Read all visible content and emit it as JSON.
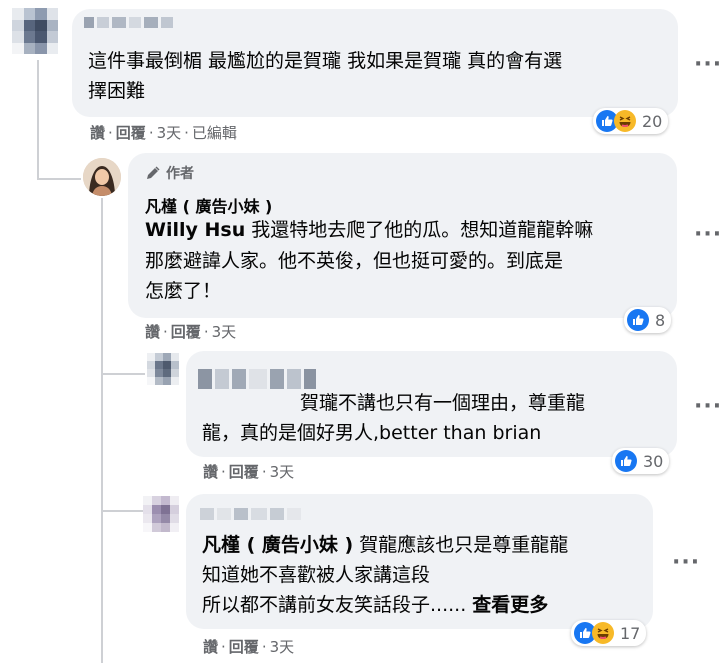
{
  "comments": [
    {
      "id": "c1",
      "text_line1": "這件事最倒楣 最尷尬的是賀瓏 我如果是賀瓏 真的會有選",
      "text_line2": "擇困難",
      "actions": {
        "like": "讚",
        "reply": "回覆",
        "time": "3天",
        "edited": "已編輯"
      },
      "reaction_count": "20",
      "reaction_icons": [
        "like-icon",
        "haha-icon"
      ]
    },
    {
      "id": "c2",
      "author_badge": "作者",
      "author_name": "凡槿 ( 廣告小妹 )",
      "mention": "Willy Hsu",
      "text_line1": " 我還特地去爬了他的瓜。想知道龍龍幹嘛",
      "text_line2": "那麼避諱人家。他不英俊，但也挺可愛的。到底是",
      "text_line3": "怎麼了！",
      "actions": {
        "like": "讚",
        "reply": "回覆",
        "time": "3天"
      },
      "reaction_count": "8",
      "reaction_icons": [
        "like-icon"
      ]
    },
    {
      "id": "c3",
      "text_line1": "賀瓏不講也只有一個理由，尊重龍",
      "text_line2": "龍，真的是個好男人,better than brian",
      "actions": {
        "like": "讚",
        "reply": "回覆",
        "time": "3天"
      },
      "reaction_count": "30",
      "reaction_icons": [
        "like-icon"
      ]
    },
    {
      "id": "c4",
      "mention": "凡槿 ( 廣告小妹 )",
      "text_line1": " 賀龍應該也只是尊重龍龍",
      "text_line2": "知道她不喜歡被人家講這段",
      "text_line3": "所以都不講前女友笑話段子......",
      "see_more": "查看更多",
      "actions": {
        "like": "讚",
        "reply": "回覆",
        "time": "3天"
      },
      "reaction_count": "17",
      "reaction_icons": [
        "like-icon",
        "haha-icon"
      ]
    }
  ],
  "more_menu_label": "···",
  "colors": {
    "bubble": "#f0f2f5",
    "meta_gray": "#65676b",
    "like_blue": "#1877f2",
    "haha_yellow": "#f7b928",
    "thread_line": "#ced0d4"
  }
}
